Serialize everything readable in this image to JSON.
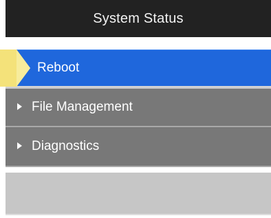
{
  "header": {
    "title": "System Status"
  },
  "nav": {
    "items": [
      {
        "label": "Reboot",
        "active": true
      },
      {
        "label": "File Management",
        "expandable": true
      },
      {
        "label": "Diagnostics",
        "expandable": true
      }
    ]
  },
  "colors": {
    "header_bg": "#222222",
    "active_bg": "#1f67dc",
    "item_bg": "#787878",
    "empty_bg": "#c6c6c6",
    "pointer": "#f4e27a"
  },
  "icons": {
    "expand": "caret-right-icon",
    "pointer": "callout-arrow-icon"
  }
}
